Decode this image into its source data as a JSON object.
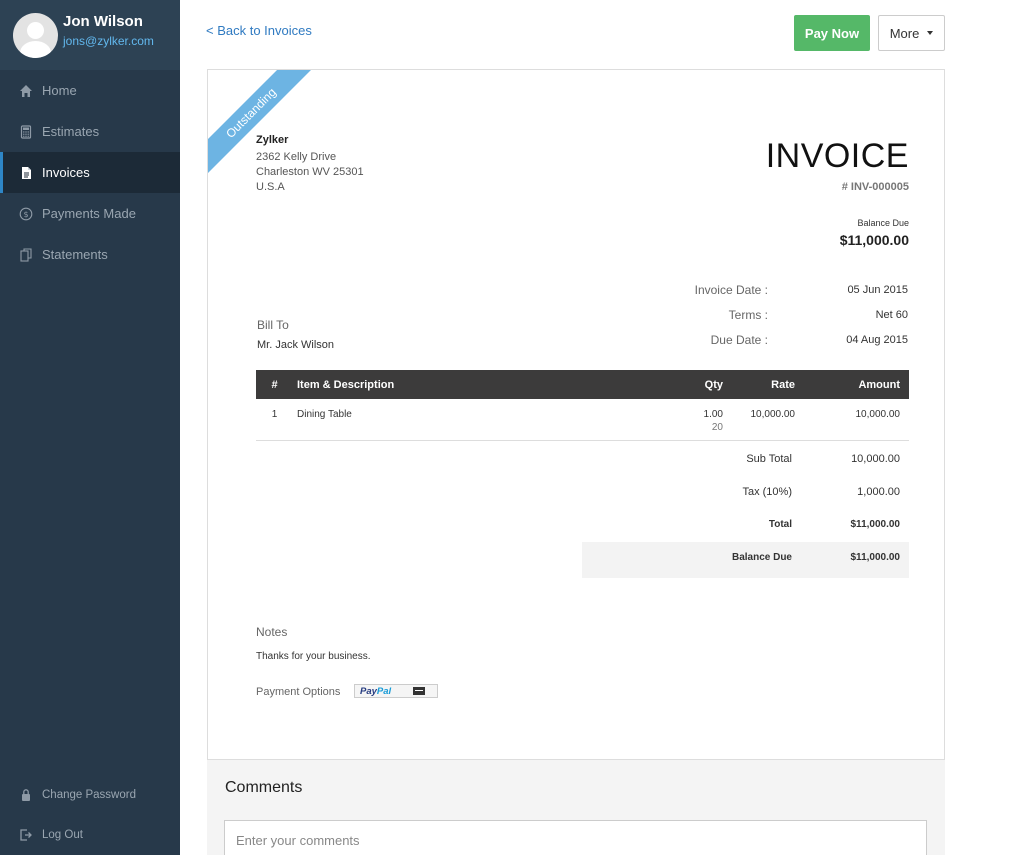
{
  "user": {
    "name": "Jon Wilson",
    "email": "jons@zylker.com"
  },
  "nav": {
    "items": [
      {
        "label": "Home",
        "icon": "home-icon"
      },
      {
        "label": "Estimates",
        "icon": "calculator-icon"
      },
      {
        "label": "Invoices",
        "icon": "document-icon",
        "active": true
      },
      {
        "label": "Payments Made",
        "icon": "dollar-circle-icon"
      },
      {
        "label": "Statements",
        "icon": "copy-icon"
      }
    ],
    "bottom": [
      {
        "label": "Change Password",
        "icon": "lock-icon"
      },
      {
        "label": "Log Out",
        "icon": "logout-icon"
      }
    ]
  },
  "header": {
    "back_label": "< Back to Invoices",
    "pay_now_label": "Pay Now",
    "more_label": "More"
  },
  "invoice": {
    "status": "Outstanding",
    "title": "INVOICE",
    "number": "# INV-000005",
    "balance_due_label": "Balance Due",
    "balance_due": "$11,000.00",
    "org": {
      "name": "Zylker",
      "address1": "2362 Kelly Drive",
      "address2": "Charleston WV  25301",
      "country": "U.S.A"
    },
    "meta": [
      {
        "label": "Invoice Date :",
        "value": "05 Jun 2015"
      },
      {
        "label": "Terms :",
        "value": "Net 60"
      },
      {
        "label": "Due Date :",
        "value": "04 Aug 2015"
      }
    ],
    "bill_to_label": "Bill To",
    "bill_to_name": "Mr. Jack Wilson",
    "table": {
      "headers": [
        "#",
        "Item & Description",
        "Qty",
        "Rate",
        "Amount"
      ],
      "rows": [
        {
          "num": "1",
          "desc": "Dining Table",
          "qty": "1.00",
          "qty_sub": "20",
          "rate": "10,000.00",
          "amount": "10,000.00"
        }
      ]
    },
    "totals": {
      "sub_total_label": "Sub Total",
      "sub_total": "10,000.00",
      "tax_label": "Tax (10%)",
      "tax": "1,000.00",
      "total_label": "Total",
      "total": "$11,000.00",
      "balance_label": "Balance Due",
      "balance": "$11,000.00"
    },
    "notes_label": "Notes",
    "notes_text": "Thanks for your business.",
    "payment_options_label": "Payment Options",
    "paypal_part1": "Pay",
    "paypal_part2": "Pal"
  },
  "comments": {
    "title": "Comments",
    "placeholder": "Enter your comments"
  },
  "colors": {
    "sidebar": "#27394a",
    "accent_blue": "#2f7ac1",
    "pay_green": "#55b868",
    "ribbon": "#6db4e3",
    "table_header": "#3c3b3b"
  }
}
